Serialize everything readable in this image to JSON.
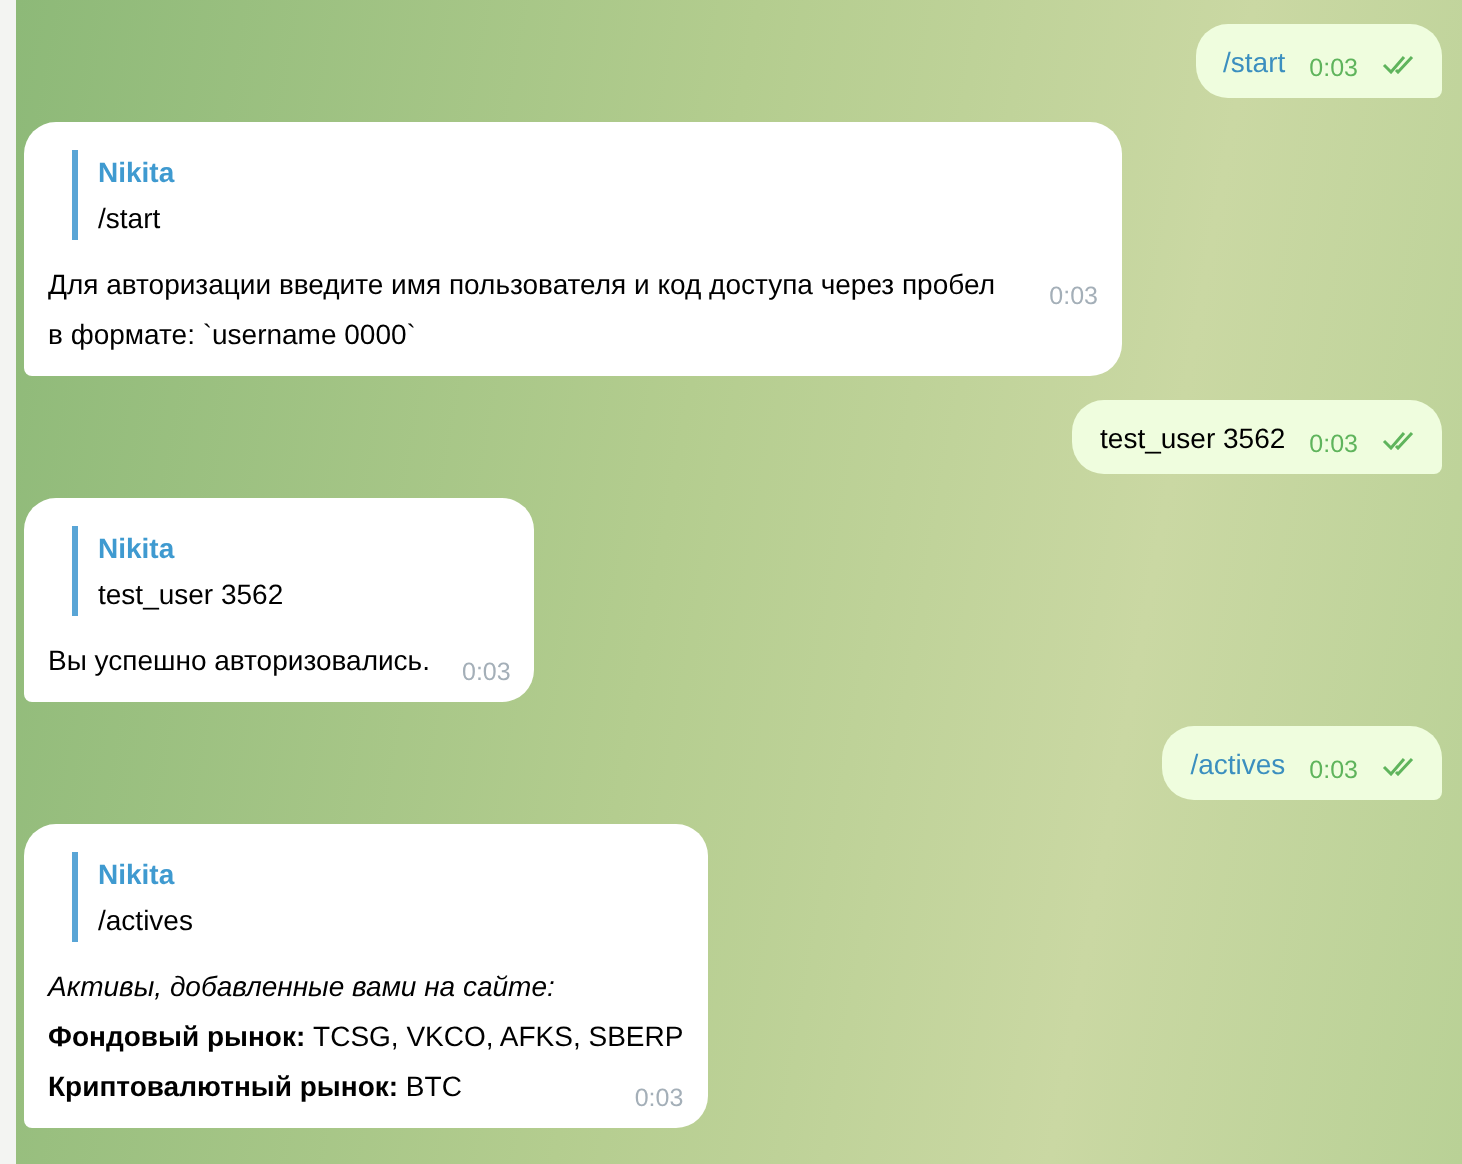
{
  "messages": [
    {
      "kind": "sent_command",
      "text": "/start",
      "time": "0:03",
      "read": true
    },
    {
      "kind": "received",
      "reply": {
        "author": "Nikita",
        "text": "/start"
      },
      "lines": [
        "Для авторизации введите имя пользователя и код доступа через пробел в формате: `username 0000`"
      ],
      "time": "0:03"
    },
    {
      "kind": "sent_text",
      "text": "test_user 3562",
      "time": "0:03",
      "read": true
    },
    {
      "kind": "received",
      "reply": {
        "author": "Nikita",
        "text": "test_user 3562"
      },
      "lines": [
        "Вы успешно авторизовались."
      ],
      "time": "0:03"
    },
    {
      "kind": "sent_command",
      "text": "/actives",
      "time": "0:03",
      "read": true
    },
    {
      "kind": "received",
      "reply": {
        "author": "Nikita",
        "text": "/actives"
      },
      "lines": [
        "*Активы, добавленные вами на сайте:*",
        "**Фондовый рынок:** TCSG, VKCO, AFKS, SBERP",
        "**Криптовалютный рынок:** BTC"
      ],
      "time": "0:03"
    }
  ]
}
